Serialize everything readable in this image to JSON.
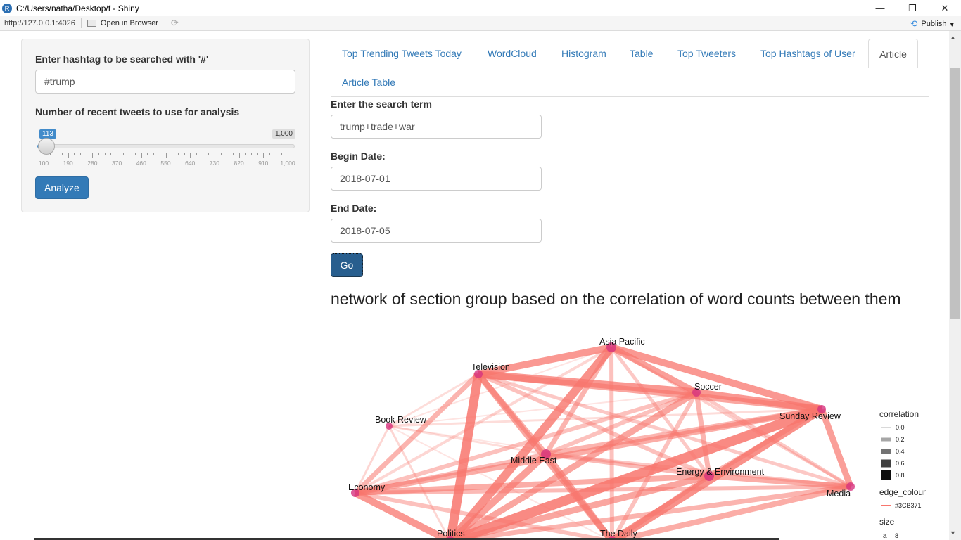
{
  "window": {
    "title": "C:/Users/natha/Desktop/f - Shiny",
    "app_icon": "R",
    "minimize_glyph": "—",
    "restore_glyph": "❐",
    "close_glyph": "✕"
  },
  "toolbar": {
    "url": "http://127.0.0.1:4026",
    "open_in_browser": "Open in Browser",
    "publish": "Publish"
  },
  "sidebar": {
    "hashtag_label": "Enter hashtag to be searched with '#'",
    "hashtag_value": "#trump",
    "tweets_label": "Number of recent tweets to use for analysis",
    "slider": {
      "min": 100,
      "max": 1000,
      "value": 113,
      "value_label": "113",
      "max_label": "1,000",
      "tick_labels": [
        "100",
        "190",
        "280",
        "370",
        "460",
        "550",
        "640",
        "730",
        "820",
        "910",
        "1,000"
      ]
    },
    "analyze_label": "Analyze"
  },
  "tabs": [
    {
      "label": "Top Trending Tweets Today",
      "active": false
    },
    {
      "label": "WordCloud",
      "active": false
    },
    {
      "label": "Histogram",
      "active": false
    },
    {
      "label": "Table",
      "active": false
    },
    {
      "label": "Top Tweeters",
      "active": false
    },
    {
      "label": "Top Hashtags of User",
      "active": false
    },
    {
      "label": "Article",
      "active": true
    },
    {
      "label": "Article Table",
      "active": false
    }
  ],
  "article": {
    "search_label": "Enter the search term",
    "search_value": "trump+trade+war",
    "begin_label": "Begin Date:",
    "begin_value": "2018-07-01",
    "end_label": "End Date:",
    "end_value": "2018-07-05",
    "go_label": "Go",
    "plot_title": "network of section group based on the correlation of word counts between them"
  },
  "network": {
    "nodes": [
      "Asia Pacific",
      "Television",
      "Soccer",
      "Sunday Review",
      "Book Review",
      "Middle East",
      "Energy & Environment",
      "Economy",
      "Media",
      "Politics",
      "The Daily"
    ],
    "legend": {
      "correlation_title": "correlation",
      "correlation_values": [
        "0.0",
        "0.2",
        "0.4",
        "0.6",
        "0.8"
      ],
      "edge_colour_title": "edge_colour",
      "edge_colour_value": "#3CB371",
      "size_title": "size",
      "size_value": "8",
      "size_key": "a"
    }
  },
  "colors": {
    "edge": "#f8766d",
    "node": "#d6337f",
    "link": "#337ab7",
    "primary_button": "#337ab7"
  }
}
